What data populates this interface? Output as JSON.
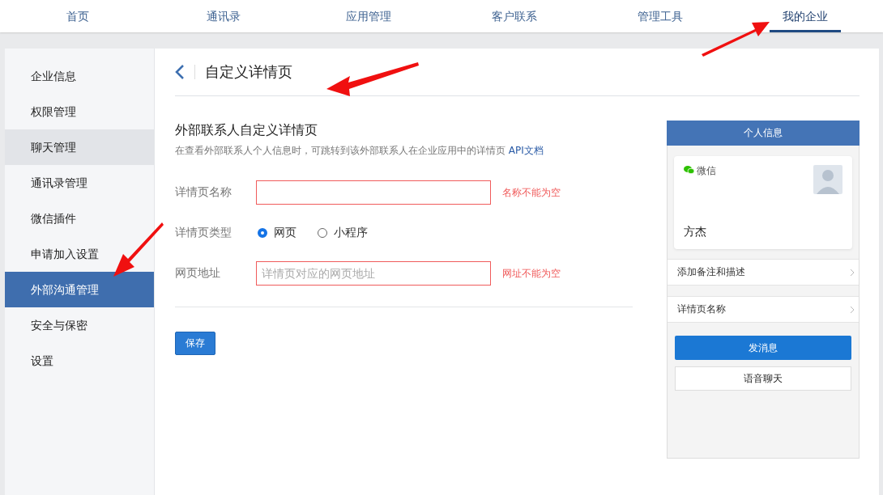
{
  "top_nav": [
    {
      "label": "首页",
      "selected": false
    },
    {
      "label": "通讯录",
      "selected": false
    },
    {
      "label": "应用管理",
      "selected": false
    },
    {
      "label": "客户联系",
      "selected": false
    },
    {
      "label": "管理工具",
      "selected": false
    },
    {
      "label": "我的企业",
      "selected": true
    }
  ],
  "sidebar": {
    "items": [
      {
        "label": "企业信息",
        "selected": false,
        "hovered": false
      },
      {
        "label": "权限管理",
        "selected": false,
        "hovered": false
      },
      {
        "label": "聊天管理",
        "selected": false,
        "hovered": true
      },
      {
        "label": "通讯录管理",
        "selected": false,
        "hovered": false
      },
      {
        "label": "微信插件",
        "selected": false,
        "hovered": false
      },
      {
        "label": "申请加入设置",
        "selected": false,
        "hovered": false
      },
      {
        "label": "外部沟通管理",
        "selected": true,
        "hovered": false
      },
      {
        "label": "安全与保密",
        "selected": false,
        "hovered": false
      },
      {
        "label": "设置",
        "selected": false,
        "hovered": false
      }
    ]
  },
  "page_title": "自定义详情页",
  "section": {
    "title": "外部联系人自定义详情页",
    "description": "在查看外部联系人个人信息时，可跳转到该外部联系人在企业应用中的详情页",
    "link": "API文档"
  },
  "form": {
    "fields": [
      {
        "kind": "text",
        "label": "详情页名称",
        "error": "名称不能为空"
      },
      {
        "kind": "radio",
        "label": "详情页类型",
        "options": [
          {
            "label": "网页",
            "selected": true
          },
          {
            "label": "小程序",
            "selected": false
          }
        ]
      },
      {
        "kind": "text",
        "label": "网页地址",
        "placeholder": "详情页对应的网页地址",
        "error": "网址不能为空"
      }
    ],
    "save_button": "保存"
  },
  "preview": {
    "header": "个人信息",
    "card": {
      "source": "微信",
      "name": "方杰"
    },
    "rows": [
      "添加备注和描述",
      "详情页名称"
    ],
    "primary_button": "发消息",
    "secondary_button": "语音聊天"
  }
}
